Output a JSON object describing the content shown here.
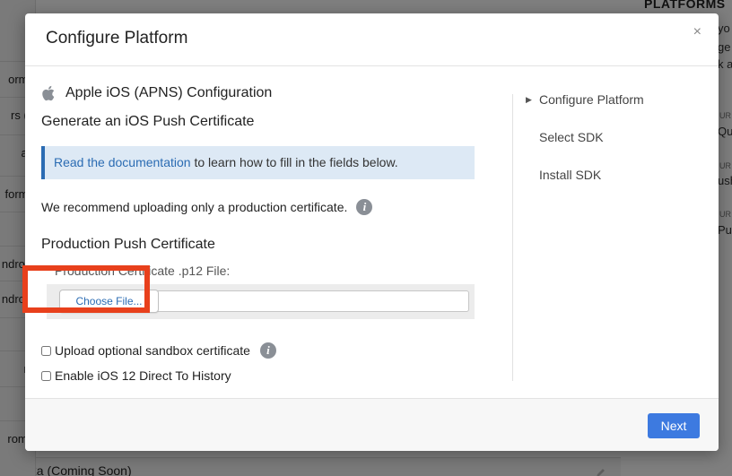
{
  "background": {
    "left_rows": [
      "orms",
      "rs (e",
      "ari",
      "forms",
      "",
      "ndroid",
      "ndroid",
      "",
      "re",
      "",
      "rome"
    ],
    "right_heading": "PLATFORMS",
    "right_texts": [
      "yo",
      "ge",
      "k a",
      "Qui",
      "ush",
      "Pu"
    ],
    "right_small": [
      "UR",
      "UR",
      "UR"
    ],
    "bottom_text": "exa (Coming Soon)"
  },
  "modal": {
    "title": "Configure Platform",
    "close_label": "×",
    "platform_title": "Apple iOS (APNS) Configuration",
    "generate_title": "Generate an iOS Push Certificate",
    "info": {
      "link_text": "Read the documentation",
      "rest_text": " to learn how to fill in the fields below."
    },
    "recommend_text": "We recommend uploading only a production certificate.",
    "info_icon_glyph": "i",
    "production_heading": "Production Push Certificate",
    "file_label": "Production Certificate .p12 File:",
    "choose_file_label": "Choose File...",
    "sandbox_label": "Upload optional sandbox certificate",
    "sandbox_checked": false,
    "direct_history_label": "Enable iOS 12 Direct To History",
    "direct_history_checked": false,
    "steps": [
      {
        "label": "Configure Platform",
        "current": true
      },
      {
        "label": "Select SDK",
        "current": false
      },
      {
        "label": "Install SDK",
        "current": false
      }
    ],
    "next_label": "Next"
  },
  "colors": {
    "accent": "#3d7ae0",
    "link": "#2b6cb3",
    "info_bg": "#dde9f5",
    "highlight": "#e8401c"
  },
  "icons": {
    "apple": "apple-icon",
    "info": "info-icon",
    "close": "close-icon",
    "step_arrow": "triangle-right-icon"
  }
}
